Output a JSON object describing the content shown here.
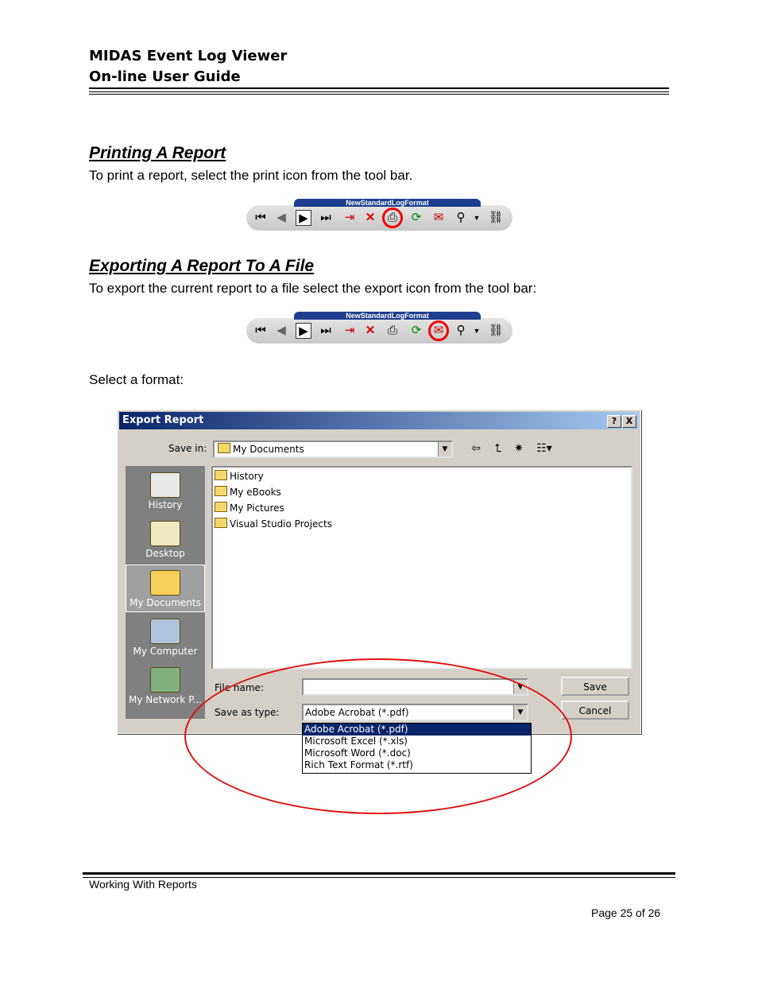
{
  "header": {
    "line1": "MIDAS Event Log Viewer",
    "line2": "On-line User Guide"
  },
  "section_print": {
    "heading": "Printing A Report",
    "text": "To print a report, select the print icon from the tool bar."
  },
  "section_export": {
    "heading": "Exporting A Report To A File",
    "text": "To export the current report to a file select the export icon from the tool bar:"
  },
  "select_format_text": "Select a format:",
  "toolbar": {
    "banner_text": "NewStandardLogFormat",
    "icons": [
      "first-page-icon",
      "prev-page-icon",
      "next-page-icon",
      "last-page-icon",
      "goto-page-icon",
      "stop-icon",
      "print-icon",
      "refresh-icon",
      "export-icon",
      "zoom-icon",
      "dropdown-icon",
      "search-icon"
    ]
  },
  "dialog": {
    "title": "Export Report",
    "help_btn": "?",
    "close_btn": "X",
    "save_in_label": "Save in:",
    "save_in_value": "My Documents",
    "places": [
      "History",
      "Desktop",
      "My Documents",
      "My Computer",
      "My Network P..."
    ],
    "files": [
      "History",
      "My eBooks",
      "My Pictures",
      "Visual Studio Projects"
    ],
    "file_name_label": "File name:",
    "file_name_value": "",
    "save_type_label": "Save as type:",
    "save_type_value": "Adobe Acrobat (*.pdf)",
    "save_button": "Save",
    "cancel_button": "Cancel",
    "type_options": [
      "Adobe Acrobat (*.pdf)",
      "Microsoft Excel (*.xls)",
      "Microsoft Word (*.doc)",
      "Rich Text Format (*.rtf)"
    ]
  },
  "footer": {
    "section": "Working With Reports",
    "page": "Page 25 of 26"
  }
}
